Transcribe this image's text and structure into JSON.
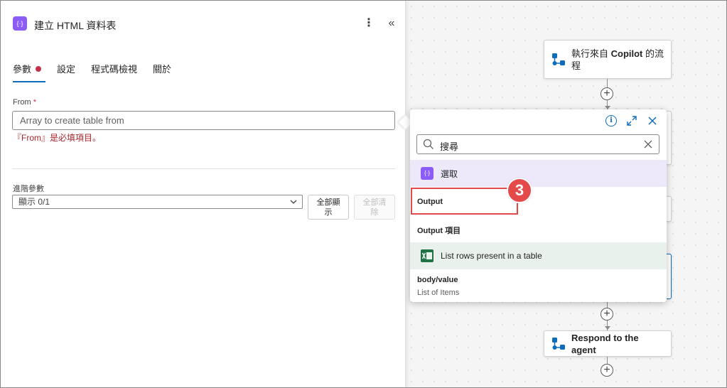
{
  "panel": {
    "title": "建立 HTML 資料表",
    "tabs": [
      {
        "label": "參數"
      },
      {
        "label": "設定"
      },
      {
        "label": "程式碼檢視"
      },
      {
        "label": "關於"
      }
    ],
    "from": {
      "label": "From",
      "required_mark": "*",
      "placeholder": "Array to create table from",
      "error": "『From』是必填項目。"
    },
    "advanced": {
      "label": "進階參數",
      "select_value": "顯示 0/1",
      "show_all_line1": "全部顯",
      "show_all_line2": "示",
      "clear_all_line1": "全部清",
      "clear_all_line2": "除"
    }
  },
  "canvas": {
    "node_top_line1_pre": "執行來自 ",
    "node_top_line1_bold": "Copilot",
    "node_top_line1_post": " 的流",
    "node_top_line2": "程",
    "node_bottom": "Respond to the agent"
  },
  "popup": {
    "search_value": "搜尋",
    "groups": [
      {
        "label": "選取",
        "icon": "select-action-icon"
      },
      {
        "label": "List rows present in a table",
        "icon": "excel-icon"
      }
    ],
    "items": {
      "output": "Output",
      "output_item": "Output 項目",
      "body_value": "body/value",
      "body_value_sub": "List of Items"
    }
  },
  "annotation": {
    "step": "3"
  },
  "colors": {
    "accent": "#0f6cbd",
    "error": "#a4262c",
    "badge": "#e44a4a",
    "action_purple": "#8b5cf6",
    "excel_green": "#217346"
  }
}
